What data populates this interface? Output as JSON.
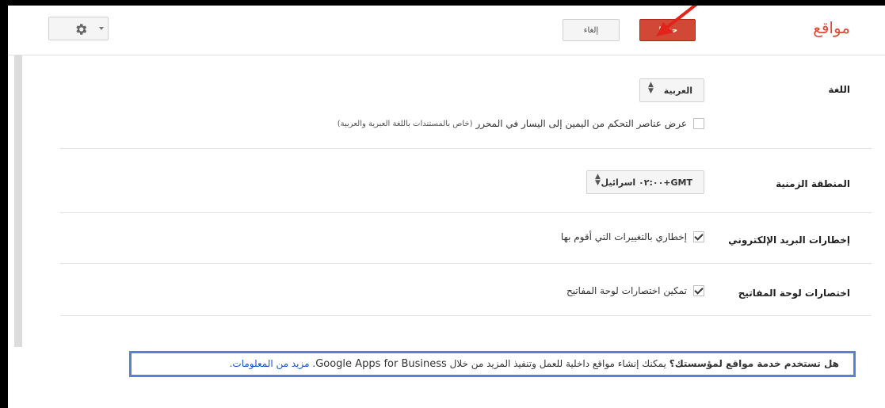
{
  "header": {
    "title": "مواقع",
    "save_label": "حفظ",
    "cancel_label": "إلغاء",
    "gear_icon": "gear-icon",
    "accent_color": "#d14836",
    "title_color": "#dd4b39"
  },
  "settings": {
    "language": {
      "label": "اللغة",
      "value": "العربية",
      "rtl_checkbox": {
        "label": "عرض عناصر التحكم من اليمين إلى اليسار في المحرر",
        "note": "(خاص بالمستندات باللغة العبرية والعربية)",
        "checked": false
      }
    },
    "timezone": {
      "label": "المنطقة الزمنية",
      "value": "GMT+٠٢:٠٠ اسرائيل"
    },
    "email": {
      "label": "إخطارات البريد الإلكتروني",
      "checkbox_label": "إخطاري بالتغييرات التي أقوم بها",
      "checked": true
    },
    "shortcuts": {
      "label": "اختصارات لوحة المفاتيح",
      "checkbox_label": "تمكين اختصارات لوحة المفاتيح",
      "checked": true
    }
  },
  "info": {
    "question": "هل تستخدم خدمة مواقع لمؤسستك؟",
    "text_before": " يمكنك إنشاء مواقع داخلية للعمل وتنفيذ المزيد من خلال ",
    "product": "Google Apps for Business",
    "period": ". ",
    "link": "مزيد من المعلومات."
  }
}
